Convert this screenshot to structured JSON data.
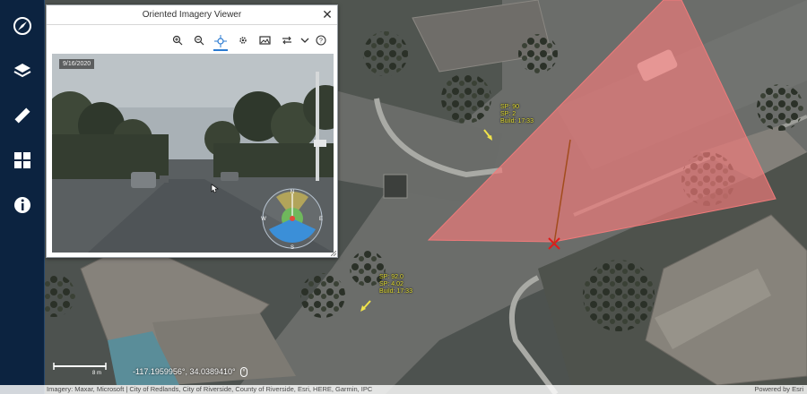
{
  "colors": {
    "rail_bg": "#0c2340",
    "fov_fill": "#f07a7a",
    "accent": "#2b7bd1",
    "label_yellow": "#e8e23a"
  },
  "rail": {
    "items": [
      {
        "name": "Explore",
        "icon": "compass-icon"
      },
      {
        "name": "Layers",
        "icon": "layers-icon"
      },
      {
        "name": "Measure",
        "icon": "ruler-icon"
      },
      {
        "name": "Basemaps",
        "icon": "grid-icon"
      },
      {
        "name": "Info",
        "icon": "info-icon"
      }
    ]
  },
  "viewer": {
    "title": "Oriented Imagery Viewer",
    "close_icon": "close-icon",
    "photo_date": "9/16/2020",
    "toolbar": [
      {
        "icon": "zoom-in-icon"
      },
      {
        "icon": "zoom-out-icon"
      },
      {
        "icon": "crosshair-icon",
        "active": true
      },
      {
        "icon": "settings-icon"
      },
      {
        "icon": "image-gallery-icon"
      },
      {
        "icon": "swap-icon"
      },
      {
        "icon": "chevron-down-icon"
      },
      {
        "icon": "help-icon"
      }
    ],
    "compass": {
      "n": "N",
      "e": "E",
      "s": "S",
      "w": "W"
    }
  },
  "map": {
    "labels": [
      {
        "text": "SP: 90\nSP: 2\nBuild: 17:33"
      },
      {
        "text": "SP: 92.0\nSP: 4.02\nBuild: 17:33"
      }
    ],
    "coordinates": "-117.1959956°, 34.0389410°",
    "scale_label": "8 m",
    "attribution_left": "Imagery: Maxar, Microsoft | City of Redlands, City of Riverside, County of Riverside, Esri, HERE, Garmin, IPC",
    "attribution_right": "Powered by Esri"
  }
}
